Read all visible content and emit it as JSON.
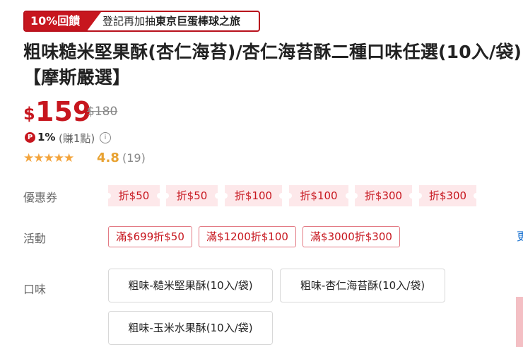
{
  "promo": {
    "tag": "10%回饋",
    "text_prefix": "登記再加抽",
    "text_bold": "東京巨蛋棒球之旅"
  },
  "product": {
    "title": "粗味糙米堅果酥(杏仁海苔)/杏仁海苔酥二種口味任選(10入/袋)【摩斯嚴選】"
  },
  "price": {
    "currency": "$",
    "current": "159",
    "original": "$180"
  },
  "points": {
    "icon": "P",
    "percent": "1%",
    "earn": "(賺1點)",
    "info_icon": "i"
  },
  "rating": {
    "stars": 4.8,
    "value": "4.8",
    "count": "(19)",
    "star_color": "#f3a43c"
  },
  "coupons": {
    "label": "優惠券",
    "items": [
      "折$50",
      "折$50",
      "折$100",
      "折$100",
      "折$300",
      "折$300"
    ]
  },
  "activities": {
    "label": "活動",
    "items": [
      "滿$699折$50",
      "滿$1200折$100",
      "滿$3000折$300"
    ],
    "more": "更"
  },
  "flavor": {
    "label": "口味",
    "options": [
      "粗味-糙米堅果酥(10入/袋)",
      "粗味-杏仁海苔酥(10入/袋)",
      "粗味-玉米水果酥(10入/袋)"
    ]
  },
  "colors": {
    "accent": "#c7161e",
    "coupon_bg": "#fde8ea",
    "link": "#1b73d1"
  }
}
